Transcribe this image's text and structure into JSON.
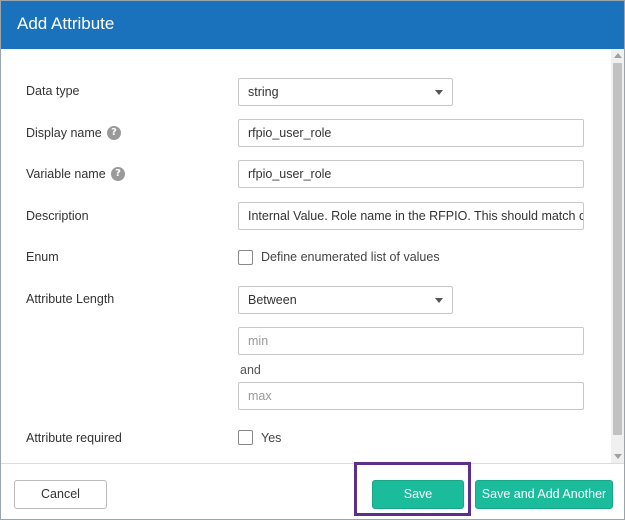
{
  "dialog": {
    "title": "Add Attribute"
  },
  "form": {
    "data_type": {
      "label": "Data type",
      "value": "string"
    },
    "display_name": {
      "label": "Display name",
      "help": "?",
      "value": "rfpio_user_role"
    },
    "variable_name": {
      "label": "Variable name",
      "help": "?",
      "value": "rfpio_user_role"
    },
    "description": {
      "label": "Description",
      "value": "Internal Value. Role name in the RFPIO. This should match one"
    },
    "enum": {
      "label": "Enum",
      "checkbox_label": "Define enumerated list of values",
      "checked": false
    },
    "attribute_length": {
      "label": "Attribute Length",
      "value": "Between",
      "min_placeholder": "min",
      "and_label": "and",
      "max_placeholder": "max"
    },
    "attribute_required": {
      "label": "Attribute required",
      "checkbox_label": "Yes",
      "checked": false
    }
  },
  "footer": {
    "cancel_label": "Cancel",
    "save_label": "Save",
    "save_another_label": "Save and Add Another"
  },
  "colors": {
    "header": "#1a72bd",
    "primary_button": "#1abc9c",
    "highlight": "#5b2f8a"
  },
  "icons": {
    "dropdown": "chevron-down-icon",
    "help": "question-circle-icon"
  }
}
